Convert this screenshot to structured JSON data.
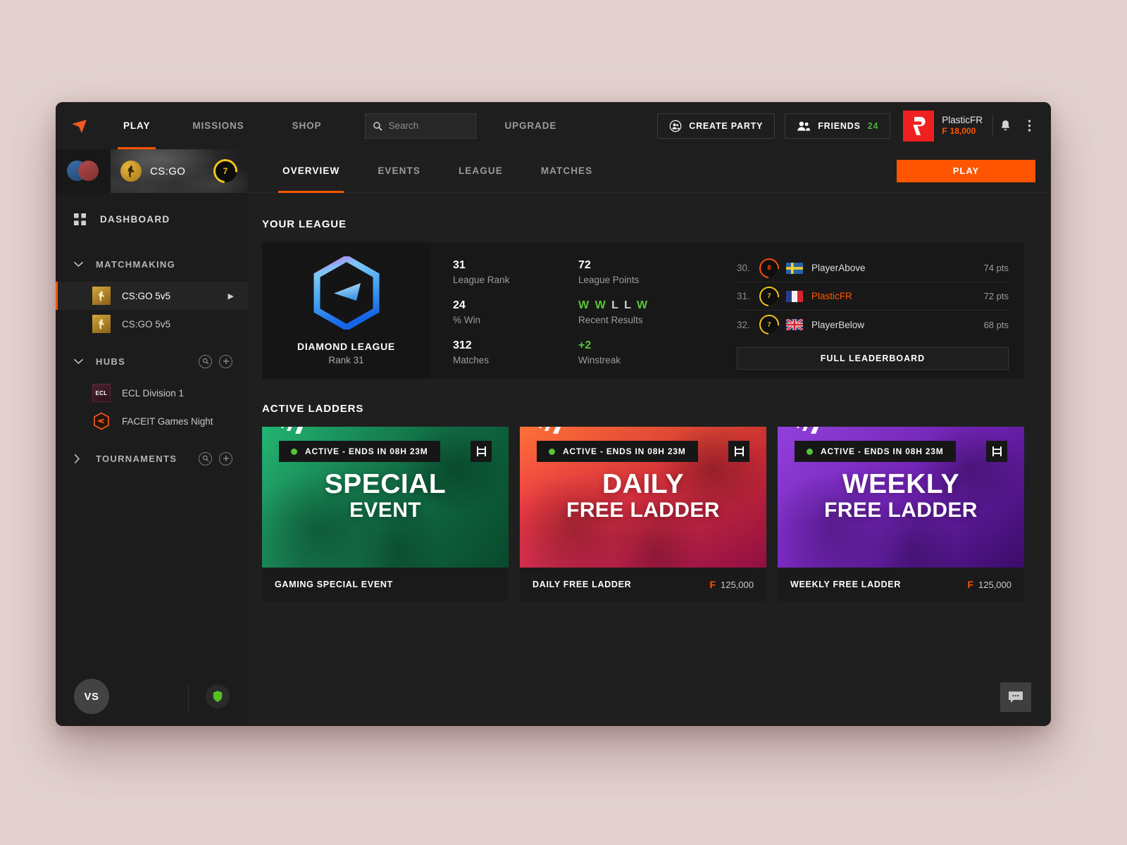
{
  "topnav": {
    "logo_icon": "faceit-arrow-logo",
    "links": [
      {
        "label": "PLAY",
        "active": true
      },
      {
        "label": "MISSIONS",
        "active": false
      },
      {
        "label": "SHOP",
        "active": false
      }
    ],
    "upgrade_label": "UPGRADE",
    "search": {
      "placeholder": "Search",
      "value": "",
      "icon": "search-icon"
    },
    "create_party_label": "CREATE PARTY",
    "friends_label": "FRIENDS",
    "friends_count": "24",
    "profile": {
      "name": "PlasticFR",
      "currency_symbol": "F",
      "coins": "18,000",
      "avatar_letter": "P"
    },
    "notifications_icon": "bell-icon",
    "more_icon": "kebab-menu-icon"
  },
  "sidebar": {
    "game_bar": {
      "game_name": "CS:GO",
      "level": "7",
      "avatars": [
        "avatar-blue",
        "avatar-red"
      ]
    },
    "dashboard_label": "DASHBOARD",
    "sections": [
      {
        "title": "MATCHMAKING",
        "expanded": true,
        "items": [
          {
            "label": "CS:GO 5v5",
            "selected": true
          },
          {
            "label": "CS:GO 5v5",
            "selected": false
          }
        ]
      },
      {
        "title": "HUBS",
        "expanded": true,
        "items": [
          {
            "label": "ECL Division 1",
            "selected": false
          },
          {
            "label": "FACEIT Games Night",
            "selected": false
          }
        ]
      },
      {
        "title": "TOURNAMENTS",
        "expanded": false,
        "items": []
      }
    ],
    "vs_label": "VS"
  },
  "tabs": [
    {
      "label": "OVERVIEW",
      "active": true
    },
    {
      "label": "EVENTS",
      "active": false
    },
    {
      "label": "LEAGUE",
      "active": false
    },
    {
      "label": "MATCHES",
      "active": false
    }
  ],
  "play_button_label": "PLAY",
  "your_league": {
    "section_title": "YOUR LEAGUE",
    "badge_name": "DIAMOND LEAGUE",
    "badge_rank": "Rank 31",
    "stats": [
      {
        "value": "31",
        "label": "League Rank",
        "green": false
      },
      {
        "value": "72",
        "label": "League Points",
        "green": false
      },
      {
        "value": "24",
        "label": "% Win",
        "green": false
      },
      {
        "value": "312",
        "label": "Matches",
        "green": false
      },
      {
        "value": "+2",
        "label": "Winstreak",
        "green": true
      }
    ],
    "recent_results_label": "Recent Results",
    "recent_results": [
      "W",
      "W",
      "L",
      "L",
      "W"
    ],
    "leaderboard": [
      {
        "position": "30.",
        "level": "8",
        "country": "se",
        "name": "PlayerAbove",
        "points": "74 pts",
        "is_me": false
      },
      {
        "position": "31.",
        "level": "7",
        "country": "fr",
        "name": "PlasticFR",
        "points": "72 pts",
        "is_me": true
      },
      {
        "position": "32.",
        "level": "7",
        "country": "gb",
        "name": "PlayerBelow",
        "points": "68 pts",
        "is_me": false
      }
    ],
    "full_leaderboard_label": "FULL LEADERBOARD"
  },
  "active_ladders": {
    "section_title": "ACTIVE LADDERS",
    "cards": [
      {
        "status": "ACTIVE - ENDS IN 08H 23M",
        "art_line1": "SPECIAL",
        "art_line2": "EVENT",
        "name": "GAMING SPECIAL EVENT",
        "prize": "",
        "currency_symbol": "",
        "theme": "green"
      },
      {
        "status": "ACTIVE - ENDS IN 08H 23M",
        "art_line1": "DAILY",
        "art_line2": "FREE LADDER",
        "name": "DAILY FREE LADDER",
        "prize": "125,000",
        "currency_symbol": "F",
        "theme": "red"
      },
      {
        "status": "ACTIVE - ENDS IN 08H 23M",
        "art_line1": "WEEKLY",
        "art_line2": "FREE LADDER",
        "name": "WEEKLY FREE LADDER",
        "prize": "125,000",
        "currency_symbol": "F",
        "theme": "purple"
      }
    ]
  },
  "chat_button_icon": "chat-bubble-icon",
  "colors": {
    "accent": "#ff5500",
    "green": "#5ac437",
    "panel": "#1f1f1f",
    "sidebar": "#1c1c1c",
    "page_bg": "#e3d2d0"
  }
}
